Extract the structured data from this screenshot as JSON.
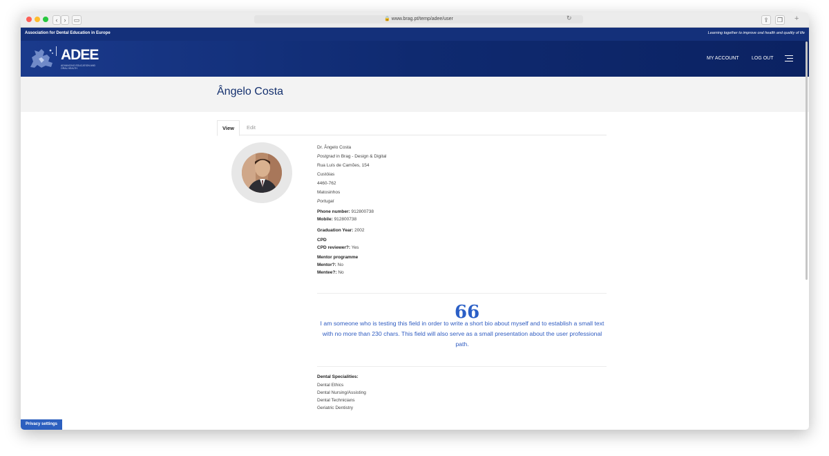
{
  "browser": {
    "url": "www.brag.pt/temp/adee/user"
  },
  "topbar": {
    "left_text": "Association for Dental Education in Europe",
    "right_text": "Learning together to improve oral health and quality of life"
  },
  "header": {
    "logo_text": "ADEE",
    "logo_sub": "ADVANCING EDUCATION AND ORAL HEALTH",
    "nav": [
      "MY ACCOUNT",
      "LOG OUT"
    ]
  },
  "page": {
    "title": "Ângelo Costa"
  },
  "tabs": [
    "View",
    "Edit"
  ],
  "profile": {
    "name": "Dr. Ângelo Costa",
    "position": "Postgrad",
    "position_connector": " in ",
    "organization": "Brag - Design & Digital",
    "address": [
      "Rua Luís de Camões, 154",
      "Custóias",
      "4460-762",
      "Matosinhos"
    ],
    "country": "Portugal",
    "phone_label": "Phone number:",
    "phone": "912800738",
    "mobile_label": "Mobile:",
    "mobile": "912800738",
    "graduation_label": "Graduation Year:",
    "graduation": "2002",
    "cpd_heading": "CPD",
    "cpd_reviewer_label": "CPD reviewer?:",
    "cpd_reviewer": "Yes",
    "mentor_heading": "Mentor programme",
    "mentor_label": "Mentor?:",
    "mentor": "No",
    "mentee_label": "Mentee?:",
    "mentee": "No"
  },
  "bio": {
    "quote_mark": "66",
    "text": "I am someone who is testing this field in order to write a short bio about myself and to establish a small text with no more than 230 chars. This field will also serve as a small presentation about the user professional path."
  },
  "specialities": {
    "heading": "Dental Specialities:",
    "items": [
      "Dental Ethics",
      "Dental Nursing/Assisting",
      "Dental Technicians",
      "Geriatric Dentistry"
    ]
  },
  "footer": {
    "privacy": "Privacy settings"
  },
  "colors": {
    "brand_navy": "#14307a",
    "accent_blue": "#2b5fc6"
  }
}
